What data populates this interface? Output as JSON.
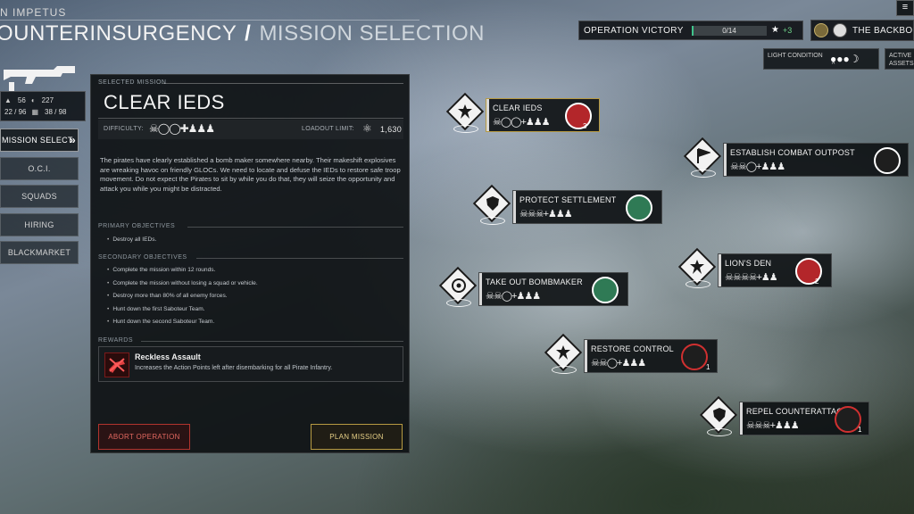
{
  "header": {
    "ship_name": "N IMPETUS",
    "title_main": "OUNTERINSURGENCY",
    "title_sep": "/",
    "title_sub": "MISSION SELECTION"
  },
  "squad": {
    "stat1": "56",
    "stat2": "227",
    "stat3": "22 / 96",
    "stat4": "38 / 98"
  },
  "nav": {
    "mission_select": "MISSION SELECT",
    "oci": "O.C.I.",
    "squads": "SQUADS",
    "hiring": "HIRING",
    "blackmarket": "BLACKMARKET"
  },
  "selected_mission": {
    "label": "SELECTED MISSION",
    "name": "CLEAR IEDS",
    "difficulty_label": "DIFFICULTY:",
    "loadout_label": "LOADOUT LIMIT:",
    "loadout_value": "1,630",
    "description": "The pirates have clearly established a bomb maker somewhere nearby. Their makeshift explosives are wreaking havoc on friendly GLOCs. We need to locate and defuse the IEDs to restore safe troop movement. Do not expect the Pirates to sit by while you do that, they will seize the opportunity and attack you while you might be distracted.",
    "primary_label": "PRIMARY OBJECTIVES",
    "primary": [
      "Destroy all IEDs."
    ],
    "secondary_label": "SECONDARY OBJECTIVES",
    "secondary": [
      "Complete the mission within 12 rounds.",
      "Complete the mission without losing a squad or vehicle.",
      "Destroy more than 80% of all enemy forces.",
      "Hunt down the first Saboteur Team.",
      "Hunt down the second Saboteur Team."
    ],
    "rewards_label": "REWARDS",
    "reward_title": "Reckless Assault",
    "reward_desc": "Increases the Action Points left after disembarking for all Pirate Infantry.",
    "abort_label": "ABORT OPERATION",
    "plan_label": "PLAN MISSION"
  },
  "hud": {
    "op_victory_label": "OPERATION VICTORY",
    "op_progress_text": "0/14",
    "op_progress_fraction": 0.0,
    "op_bonus": "+3",
    "faction_name": "THE BACKBO",
    "menu_icon": "hamburger-icon",
    "light_condition_label": "LIGHT CONDITION",
    "active_assets_label": "ACTIVE ASSETS"
  },
  "map_missions": [
    {
      "title": "CLEAR IEDS",
      "req": "☠◯◯+",
      "badge_num": "3",
      "selected": true,
      "badge_color": "#b3262a"
    },
    {
      "title": "ESTABLISH COMBAT OUTPOST",
      "req": "☠☠◯+",
      "badge_num": "",
      "selected": false,
      "badge_color": "#2f7a55"
    },
    {
      "title": "PROTECT SETTLEMENT",
      "req": "☠☠☠+",
      "badge_num": "",
      "selected": false,
      "badge_color": "#2f7a55"
    },
    {
      "title": "LION'S DEN",
      "req": "☠☠☠☠+",
      "badge_num": "2",
      "selected": false,
      "badge_color": "#b3262a"
    },
    {
      "title": "TAKE OUT BOMBMAKER",
      "req": "☠☠◯+",
      "badge_num": "",
      "selected": false,
      "badge_color": "#2f7a55"
    },
    {
      "title": "RESTORE CONTROL",
      "req": "☠☠◯+",
      "badge_num": "1",
      "selected": false,
      "badge_color": "#b3262a"
    },
    {
      "title": "REPEL COUNTERATTACK",
      "req": "☠☠☠+",
      "badge_num": "1",
      "selected": false,
      "badge_color": "#b3262a"
    }
  ]
}
